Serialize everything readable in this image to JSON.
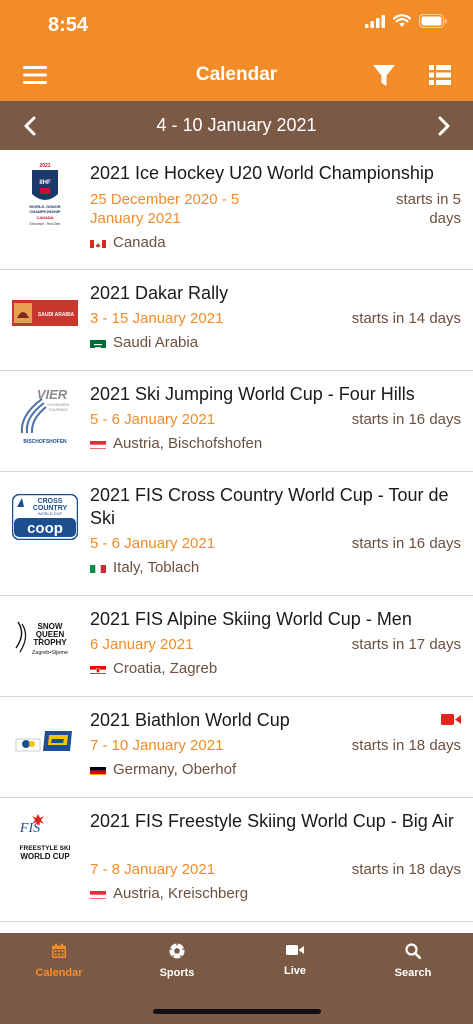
{
  "status_bar": {
    "time": "8:54"
  },
  "header": {
    "title": "Calendar"
  },
  "week": {
    "label": "4 - 10 January 2021"
  },
  "events": [
    {
      "title": "2021 Ice Hockey U20 World Championship",
      "dates": "25 December 2020 - 5 January 2021",
      "status": "starts in 5 days",
      "location": "Canada",
      "logo_text": {
        "line1": "2021",
        "line2": "IIHF",
        "line3": "WORLD JUNIOR",
        "line4": "CHAMPIONSHIP",
        "line5": "CANADA",
        "line6": "Edmonton - Red Deer"
      }
    },
    {
      "title": "2021 Dakar Rally",
      "dates": "3 - 15 January 2021",
      "status": "starts in 14 days",
      "location": "Saudi Arabia",
      "logo_text": {
        "line1": "SAUDI ARABIA"
      }
    },
    {
      "title": "2021 Ski Jumping World Cup - Four Hills",
      "dates": "5 - 6 January 2021",
      "status": "starts in 16 days",
      "location": "Austria, Bischofshofen",
      "logo_text": {
        "line1": "VIER",
        "line2": "SCHANZEN",
        "line3": "TOURNEE",
        "line4": "BISCHOFSHOFEN"
      }
    },
    {
      "title": "2021 FIS Cross Country World Cup - Tour de Ski",
      "dates": "5 - 6 January 2021",
      "status": "starts in 16 days",
      "location": "Italy, Toblach",
      "logo_text": {
        "line1": "CROSS",
        "line2": "COUNTRY",
        "line3": "WORLD CUP",
        "line4": "coop"
      }
    },
    {
      "title": "2021 FIS Alpine Skiing World Cup - Men",
      "dates": "6 January 2021",
      "status": "starts in 17 days",
      "location": "Croatia, Zagreb",
      "logo_text": {
        "line1": "SNOW",
        "line2": "QUEEN",
        "line3": "TROPHY",
        "line4": "Zagreb•Sljeme"
      }
    },
    {
      "title": "2021 Biathlon World Cup",
      "dates": "7 - 10 January 2021",
      "status": "starts in 18 days",
      "location": "Germany, Oberhof"
    },
    {
      "title": "2021 FIS Freestyle Skiing World Cup - Big Air",
      "dates": "7 - 8 January 2021",
      "status": "starts in 18 days",
      "location": "Austria, Kreischberg",
      "logo_text": {
        "line1": "FIS",
        "line2": "FREESTYLE SKI",
        "line3": "WORLD CUP"
      }
    }
  ],
  "tabs": [
    {
      "label": "Calendar",
      "icon": "calendar-icon"
    },
    {
      "label": "Sports",
      "icon": "soccer-ball-icon"
    },
    {
      "label": "Live",
      "icon": "video-camera-icon"
    },
    {
      "label": "Search",
      "icon": "search-icon"
    }
  ],
  "colors": {
    "accent": "#f28c28",
    "brown": "#7b5a45",
    "text_brown": "#6b5040",
    "live_red": "#e5251b"
  }
}
